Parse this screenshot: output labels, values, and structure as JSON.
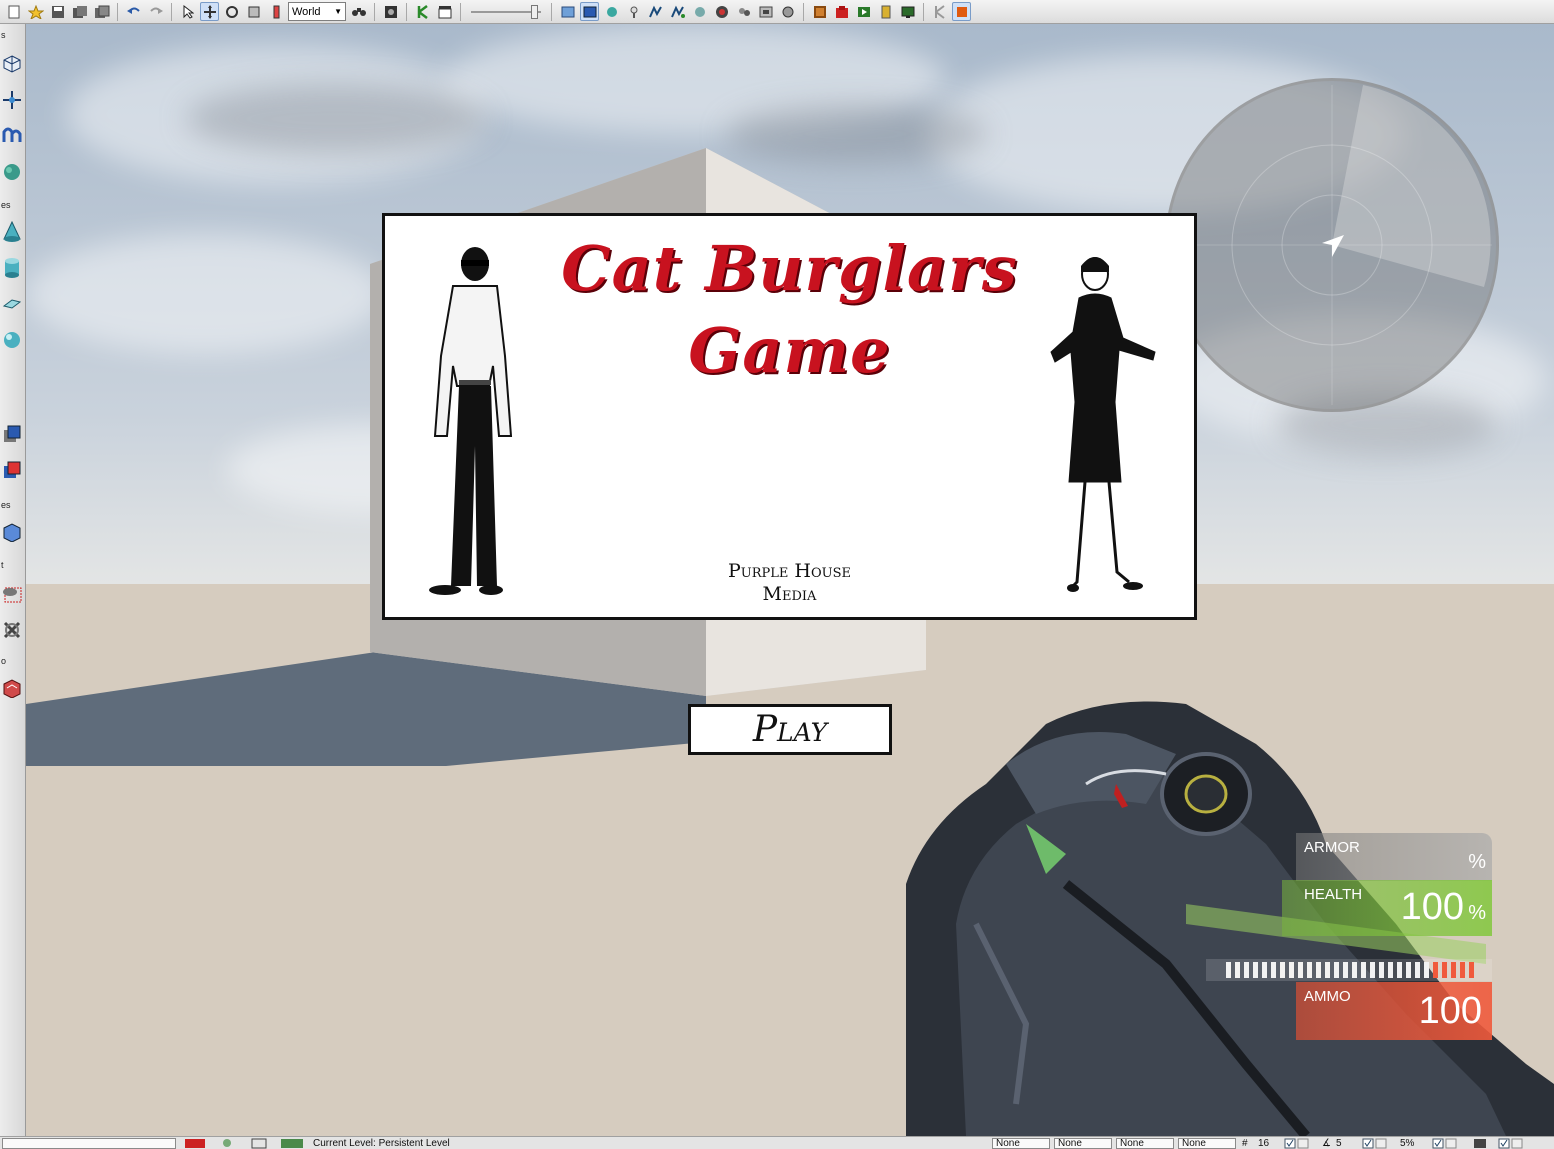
{
  "toolbar": {
    "coord_system": "World"
  },
  "left_toolbar": {
    "labels": [
      "s",
      "es",
      "es",
      "t",
      "o"
    ]
  },
  "game": {
    "title_line1": "Cat Burglars",
    "title_line2": "Game",
    "studio_line1": "Purple House",
    "studio_line2": "Media",
    "play_label": "Play"
  },
  "hud": {
    "armor_label": "ARMOR",
    "armor_unit": "%",
    "health_label": "HEALTH",
    "health_value": "100",
    "health_unit": "%",
    "ammo_label": "AMMO",
    "ammo_value": "100"
  },
  "statusbar": {
    "current_level": "Current Level:  Persistent Level",
    "slot1": "None",
    "slot2": "None",
    "slot3": "None",
    "slot4": "None",
    "grid": "16",
    "rotation": "5",
    "scale": "5%"
  },
  "colors": {
    "title_red": "#c8121f",
    "health_green": "#82c83c",
    "ammo_red": "#f05a3c"
  }
}
